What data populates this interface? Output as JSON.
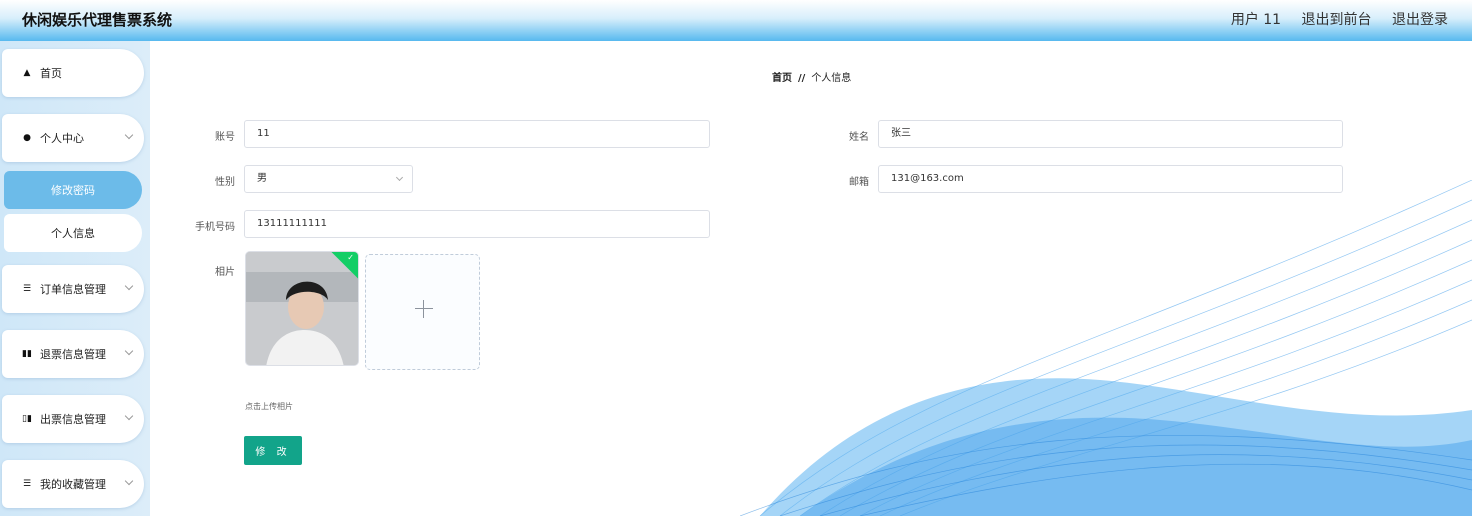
{
  "header": {
    "title": "休闲娱乐代理售票系统",
    "user": "用户 11",
    "to_front": "退出到前台",
    "logout": "退出登录"
  },
  "sidebar": {
    "home": "首页",
    "personal_center": "个人中心",
    "change_password": "修改密码",
    "personal_info": "个人信息",
    "order_mgmt": "订单信息管理",
    "refund_mgmt": "退票信息管理",
    "ticket_mgmt": "出票信息管理",
    "favorite_mgmt": "我的收藏管理"
  },
  "breadcrumb": {
    "home": "首页",
    "separator": "//",
    "current": "个人信息"
  },
  "form": {
    "account_label": "账号",
    "account_value": "11",
    "name_label": "姓名",
    "name_value": "张三",
    "gender_label": "性别",
    "gender_value": "男",
    "email_label": "邮箱",
    "email_value": "131@163.com",
    "phone_label": "手机号码",
    "phone_value": "13111111111",
    "photo_label": "相片",
    "upload_hint": "点击上传相片",
    "submit_label": "修 改"
  },
  "colors": {
    "accent": "#12a48a",
    "sidebar_active": "#6cbbe9",
    "header_blue": "#57b9ef",
    "wave_blue": "#3d9be9"
  }
}
